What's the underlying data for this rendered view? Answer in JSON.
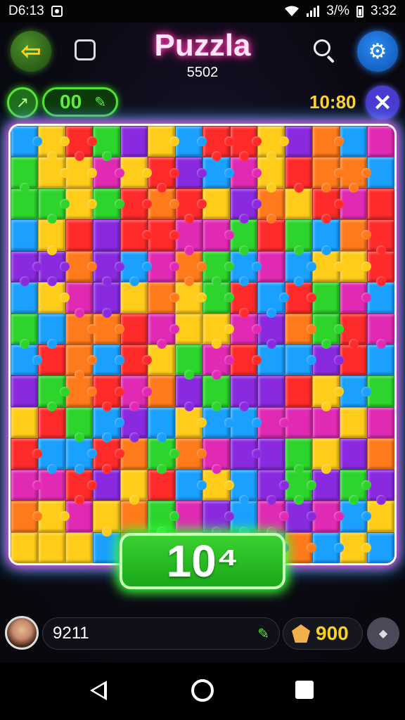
{
  "status_bar": {
    "time_left": "D6:13",
    "battery": "3/%",
    "time_right": "3:32"
  },
  "header": {
    "back_icon": "arrow-left-icon",
    "title": "Puzzla",
    "subtitle": "5502",
    "search_icon": "search-icon",
    "settings_icon": "gear-icon"
  },
  "hud": {
    "hint_icon": "compass-icon",
    "moves": "00",
    "moves_icon": "pencil-icon",
    "timer": "10:80",
    "close_icon": "close-icon"
  },
  "board": {
    "rows": 14,
    "cols": 14,
    "palette": [
      "#ff2a2a",
      "#ffcc1a",
      "#2cd42c",
      "#1aa0ff",
      "#8a2ae0",
      "#e02ab4",
      "#ff7a1a"
    ],
    "glow_colors": [
      "#ff3ad0",
      "#3ab0ff",
      "#ffffff"
    ]
  },
  "score_display": "10⁴",
  "footer": {
    "user_id": "9211",
    "pen_icon": "pencil-icon",
    "coins": "900",
    "coin_icon": "crown-coin-icon",
    "gem_icon": "diamond-icon"
  },
  "nav": {
    "back_icon": "back-triangle-icon",
    "home_icon": "home-circle-icon",
    "recent_icon": "recent-square-icon"
  }
}
